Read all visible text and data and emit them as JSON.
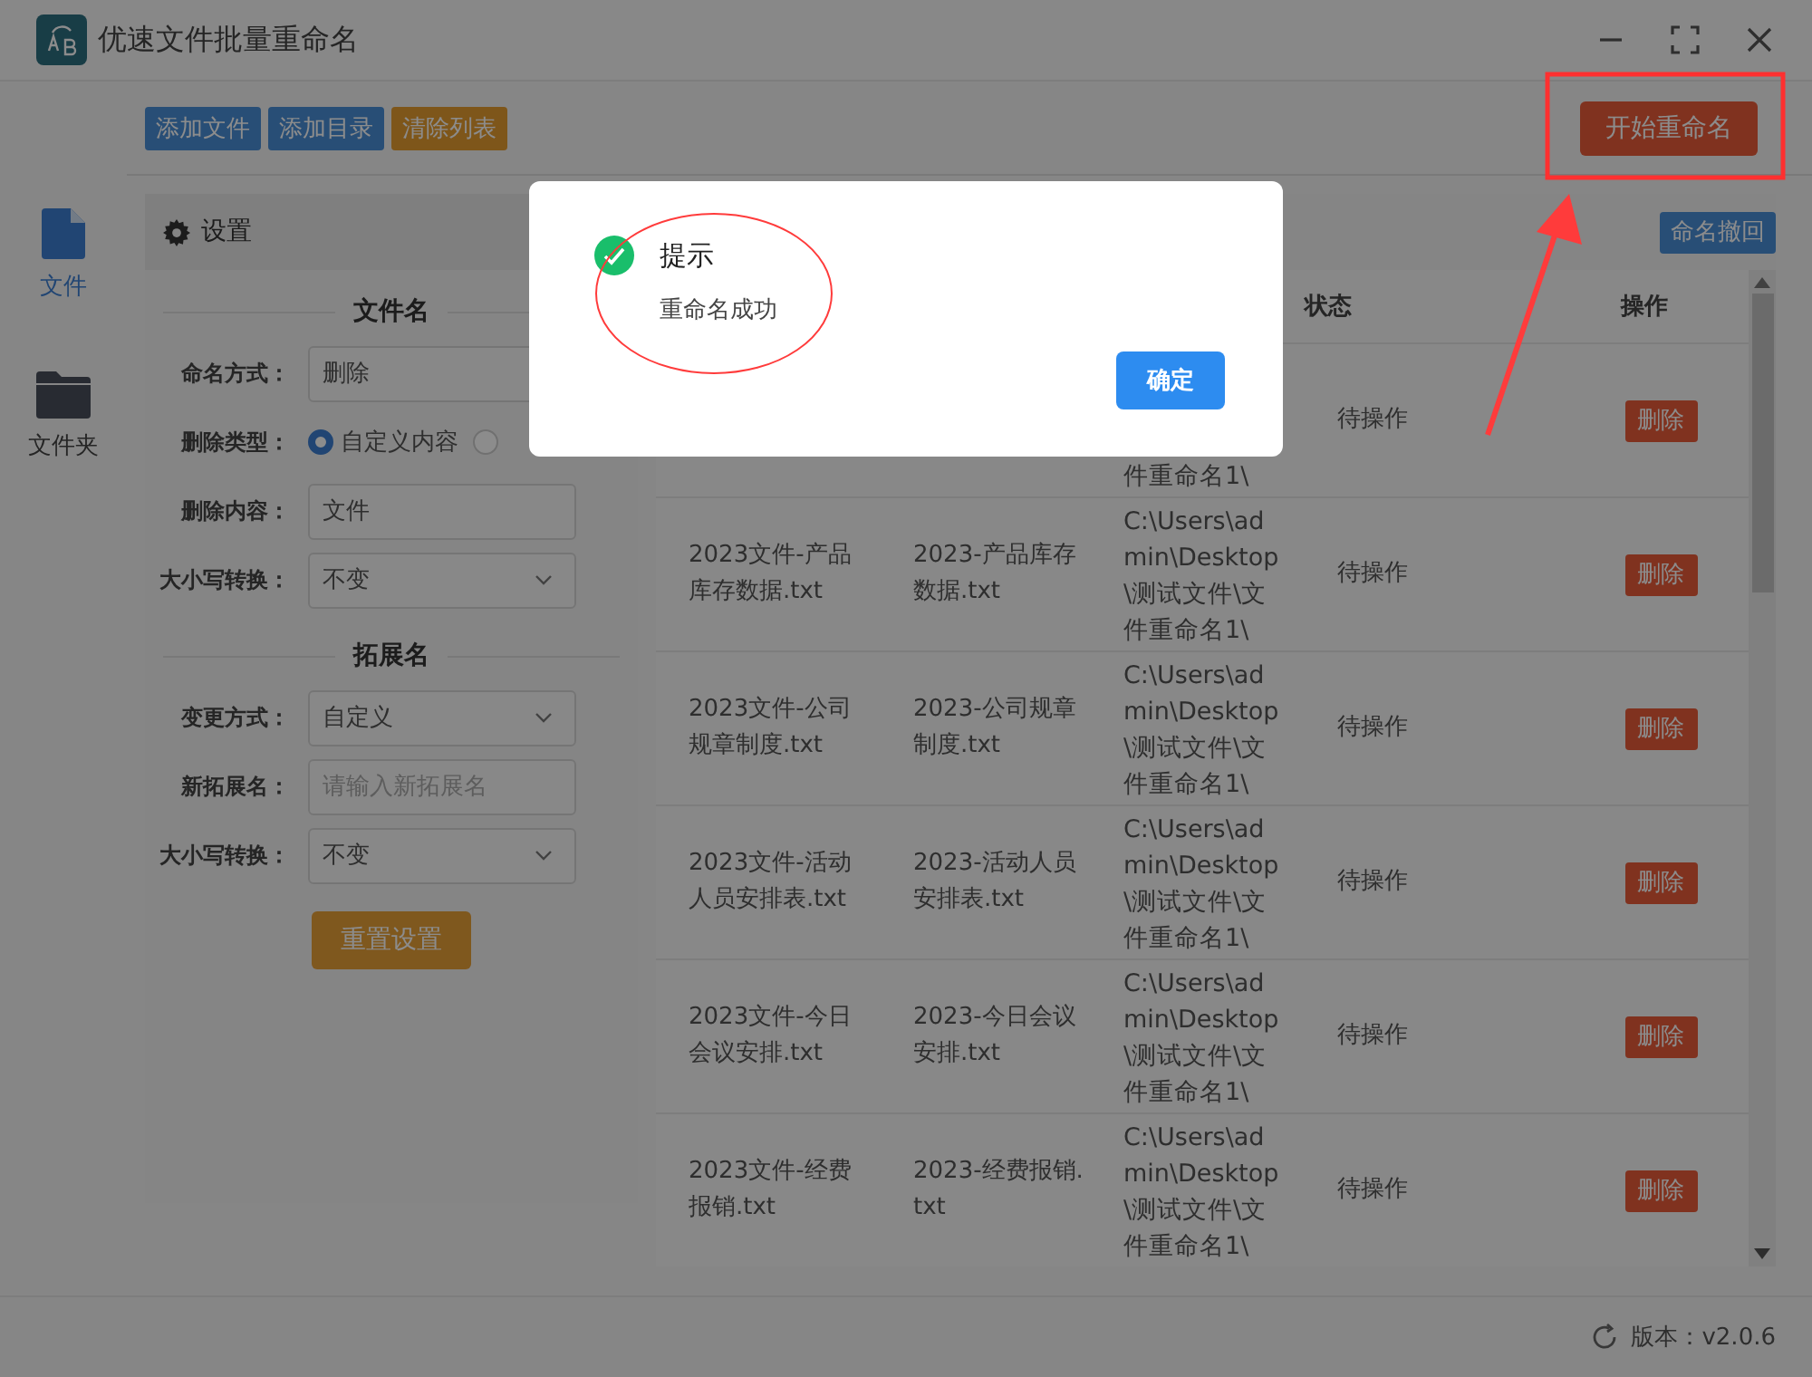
{
  "window": {
    "title": "优速文件批量重命名"
  },
  "toolbar": {
    "buttons": [
      {
        "label": "添加文件",
        "kind": "primary"
      },
      {
        "label": "添加目录",
        "kind": "primary"
      },
      {
        "label": "清除列表",
        "kind": "warning"
      }
    ],
    "start_button": "开始重命名"
  },
  "sidebar": {
    "items": [
      {
        "label": "文件",
        "kind": "file",
        "selected": true
      },
      {
        "label": "文件夹",
        "kind": "folder",
        "selected": false
      }
    ]
  },
  "settings": {
    "title": "设置",
    "sections": [
      {
        "heading": "文件名",
        "fields": [
          {
            "label": "命名方式：",
            "kind": "select",
            "value": "删除"
          },
          {
            "label": "删除类型：",
            "kind": "radio",
            "options": [
              {
                "label": "自定义内容",
                "selected": true
              },
              {
                "selected": false
              }
            ]
          },
          {
            "label": "删除内容：",
            "kind": "input",
            "value": "文件"
          },
          {
            "label": "大小写转换：",
            "kind": "select",
            "value": "不变"
          }
        ]
      },
      {
        "heading": "拓展名",
        "fields": [
          {
            "label": "变更方式：",
            "kind": "select",
            "value": "自定义"
          },
          {
            "label": "新拓展名：",
            "kind": "input",
            "placeholder": "请输入新拓展名"
          },
          {
            "label": "大小写转换：",
            "kind": "select",
            "value": "不变"
          }
        ]
      }
    ],
    "reset_button": "重置设置"
  },
  "table": {
    "undo_button": "命名撤回",
    "columns": [
      "状态",
      "操作"
    ],
    "rows": [
      {
        "path": "件重命名1\\",
        "status": "待操作",
        "action": "删除"
      },
      {
        "original_name": "2023文件-产品库存数据.txt",
        "new_name": "2023-产品库存数据.txt",
        "path": "C:\\Users\\admin\\Desktop\\测试文件\\文件重命名1\\",
        "status": "待操作",
        "action": "删除"
      },
      {
        "original_name": "2023文件-公司规章制度.txt",
        "new_name": "2023-公司规章制度.txt",
        "path": "C:\\Users\\admin\\Desktop\\测试文件\\文件重命名1\\",
        "status": "待操作",
        "action": "删除"
      },
      {
        "original_name": "2023文件-活动人员安排表.txt",
        "new_name": "2023-活动人员安排表.txt",
        "path": "C:\\Users\\admin\\Desktop\\测试文件\\文件重命名1\\",
        "status": "待操作",
        "action": "删除"
      },
      {
        "original_name": "2023文件-今日会议安排.txt",
        "new_name": "2023-今日会议安排.txt",
        "path": "C:\\Users\\admin\\Desktop\\测试文件\\文件重命名1\\",
        "status": "待操作",
        "action": "删除"
      },
      {
        "original_name": "2023文件-经费报销.txt",
        "new_name": "2023-经费报销.txt",
        "path": "C:\\Users\\admin\\Desktop\\测试文件\\文件重命名1\\",
        "status": "待操作",
        "action": "删除"
      }
    ]
  },
  "footer": {
    "version": "版本：v2.0.6"
  },
  "dialog": {
    "title": "提示",
    "message": "重命名成功",
    "confirm": "确定"
  }
}
